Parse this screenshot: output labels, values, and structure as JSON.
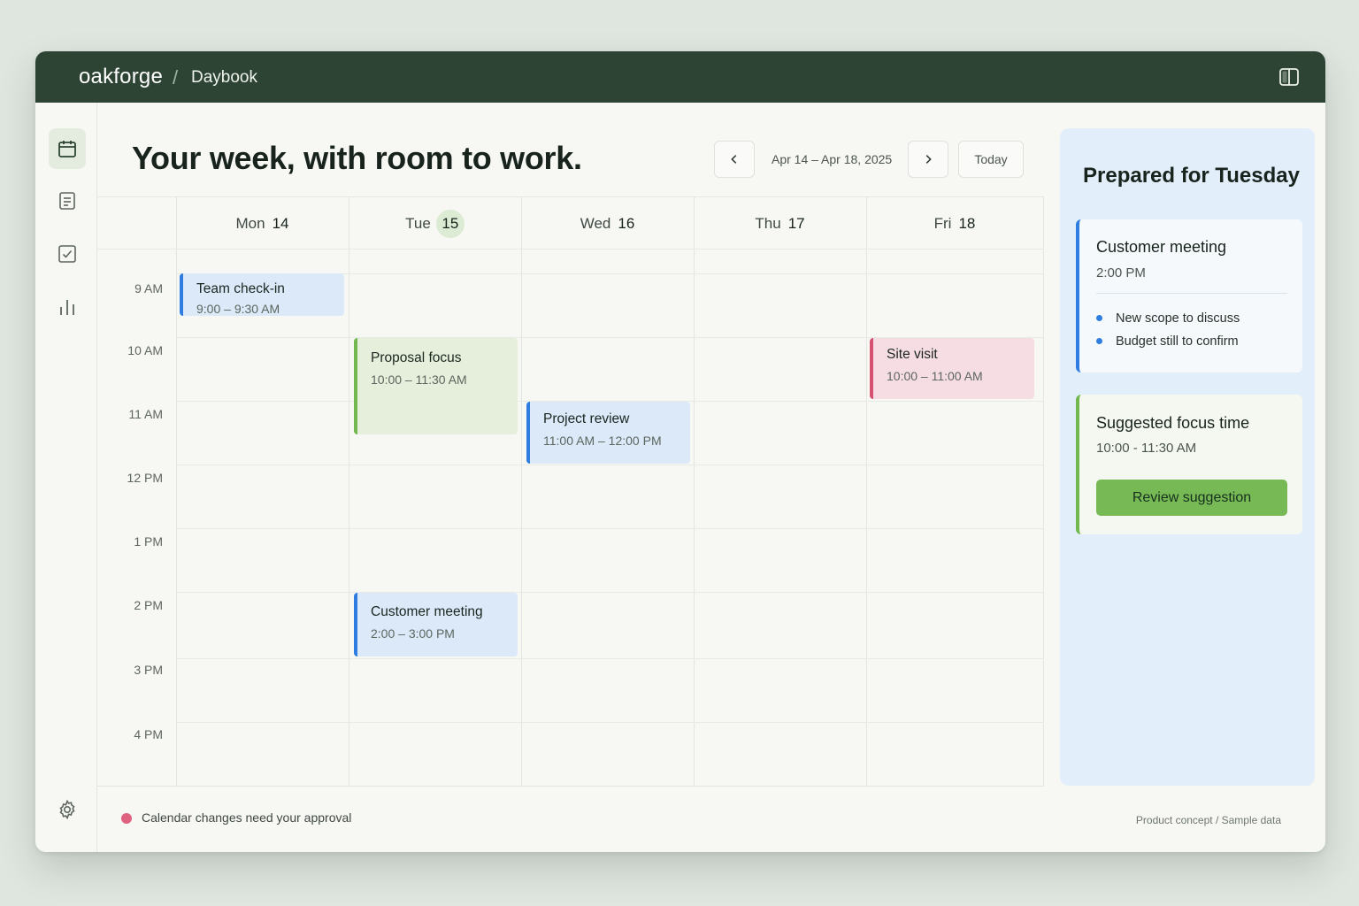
{
  "app": {
    "brand": "oakforge",
    "separator": "/",
    "section": "Daybook"
  },
  "icons": {
    "panel_toggle": "split-panel-icon",
    "nav": [
      "calendar-icon",
      "document-icon",
      "checkbox-icon",
      "bar-chart-icon"
    ],
    "settings": "gear-icon",
    "prev": "chevron-left-icon",
    "next": "chevron-right-icon"
  },
  "header": {
    "title": "Your week, with room to work.",
    "date_range": "Apr 14 – Apr 18, 2025",
    "today_label": "Today"
  },
  "calendar": {
    "days": [
      {
        "name": "Mon",
        "num": "14",
        "today": false
      },
      {
        "name": "Tue",
        "num": "15",
        "today": true
      },
      {
        "name": "Wed",
        "num": "16",
        "today": false
      },
      {
        "name": "Thu",
        "num": "17",
        "today": false
      },
      {
        "name": "Fri",
        "num": "18",
        "today": false
      }
    ],
    "times": [
      "9 AM",
      "10 AM",
      "11 AM",
      "12 PM",
      "1 PM",
      "2 PM",
      "3 PM",
      "4 PM"
    ],
    "events": [
      {
        "title": "Team check-in",
        "time": "9:00 – 9:30 AM",
        "day": "Mon",
        "color": "#2f7de0"
      },
      {
        "title": "Proposal focus",
        "time": "10:00 – 11:30 AM",
        "day": "Tue",
        "color": "#72b84f"
      },
      {
        "title": "Project review",
        "time": "11:00 AM – 12:00 PM",
        "day": "Wed",
        "color": "#2f7de0"
      },
      {
        "title": "Site visit",
        "time": "10:00 – 11:00 AM",
        "day": "Fri",
        "color": "#d65171"
      },
      {
        "title": "Customer meeting",
        "time": "2:00 – 3:00 PM",
        "day": "Tue",
        "color": "#2f7de0"
      }
    ]
  },
  "side_panel": {
    "title": "Prepared for Tuesday",
    "meeting_card": {
      "title": "Customer meeting",
      "time": "2:00 PM",
      "bullets": [
        "New scope to discuss",
        "Budget still to confirm"
      ]
    },
    "focus_card": {
      "title": "Suggested focus time",
      "time": "10:00 - 11:30 AM",
      "button": "Review suggestion"
    }
  },
  "footer": {
    "notice": "Calendar changes need your approval",
    "meta": "Product concept  /  Sample data"
  },
  "colors": {
    "topbar": "#2d4434",
    "accent_blue": "#2f7de0",
    "accent_green": "#72b84f",
    "accent_red": "#d65171",
    "panel_bg": "#e3eefb"
  }
}
